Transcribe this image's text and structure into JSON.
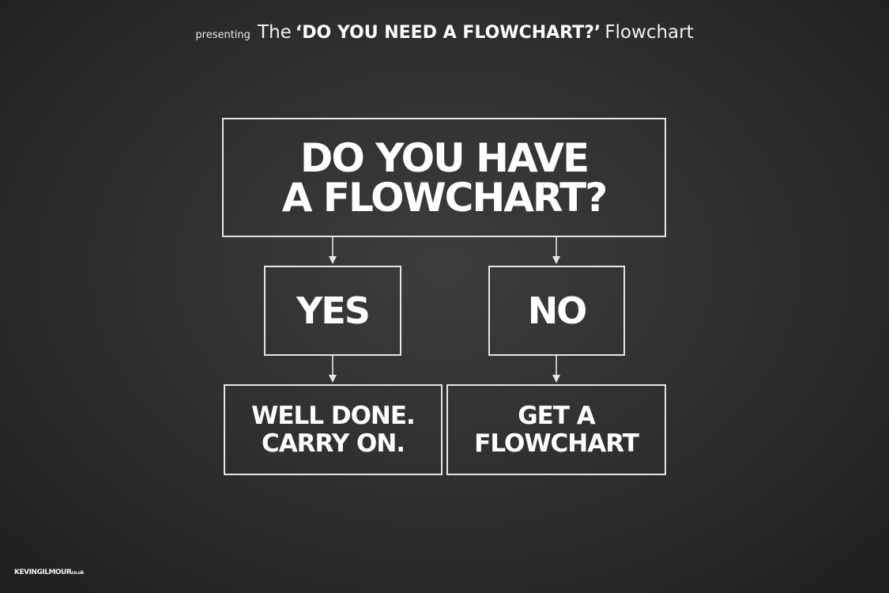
{
  "header": {
    "presenting": "presenting",
    "the": "The",
    "bold_title": "‘DO YOU NEED A FLOWCHART?’",
    "flowchart_word": "Flowchart"
  },
  "nodes": {
    "question": "DO YOU HAVE\nA FLOWCHART?",
    "yes": "YES",
    "no": "NO",
    "well_done": "WELL DONE.\nCARRY ON.",
    "get_flowchart": "GET A\nFLOWCHART"
  },
  "edges": [
    {
      "from": "question",
      "to": "yes"
    },
    {
      "from": "question",
      "to": "no"
    },
    {
      "from": "yes",
      "to": "well_done"
    },
    {
      "from": "no",
      "to": "get_flowchart"
    }
  ],
  "watermark": {
    "main": "KEVINGILMOUR",
    "suffix": "co.uk"
  },
  "colors": {
    "background": "#2e3031",
    "chalk": "#e6e6e6",
    "text": "#ffffff"
  }
}
